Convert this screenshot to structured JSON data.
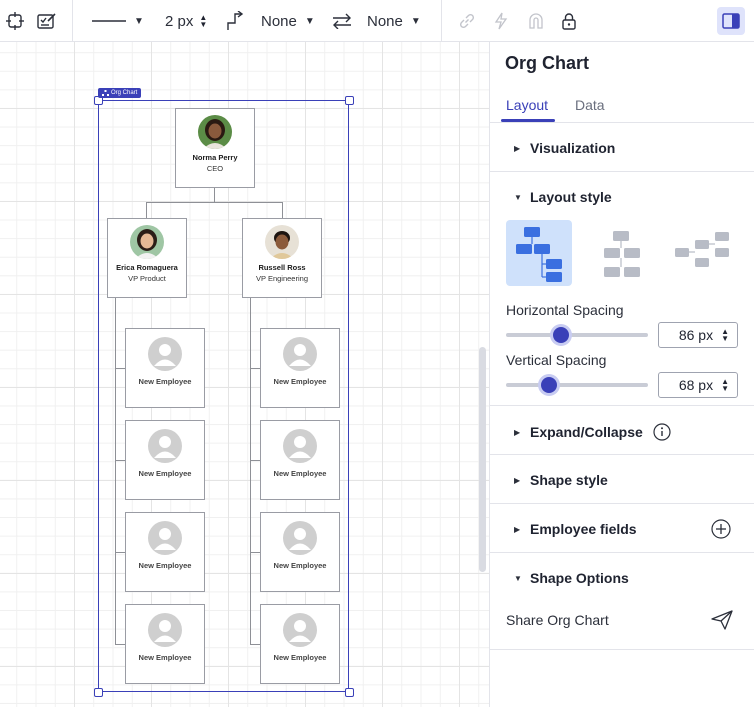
{
  "toolbar": {
    "line_width": "2 px",
    "start_arrow": "None",
    "end_arrow": "None",
    "icons": [
      "crop-icon",
      "checklist-icon",
      "line-style-icon",
      "line-width-stepper",
      "connector-elbow-icon",
      "swap-arrows-icon",
      "link-icon",
      "lightning-icon",
      "magnet-icon",
      "lock-icon",
      "panel-toggle-icon"
    ]
  },
  "canvas": {
    "chart_tag": "Org Chart",
    "ceo": {
      "name": "Norma Perry",
      "title": "CEO"
    },
    "vps": [
      {
        "name": "Erica Romaguera",
        "title": "VP Product"
      },
      {
        "name": "Russell Ross",
        "title": "VP Engineering"
      }
    ],
    "employees": [
      "New Employee",
      "New Employee",
      "New Employee",
      "New Employee",
      "New Employee",
      "New Employee",
      "New Employee",
      "New Employee"
    ]
  },
  "panel": {
    "title": "Org Chart",
    "tabs": [
      {
        "label": "Layout",
        "active": true
      },
      {
        "label": "Data",
        "active": false
      }
    ],
    "sections": {
      "visualization": "Visualization",
      "layout_style": "Layout style",
      "expand_collapse": "Expand/Collapse",
      "shape_style": "Shape style",
      "employee_fields": "Employee fields",
      "shape_options": "Shape Options"
    },
    "horizontal_spacing": {
      "label": "Horizontal Spacing",
      "value": "86 px",
      "slider_fraction": 0.39
    },
    "vertical_spacing": {
      "label": "Vertical Spacing",
      "value": "68 px",
      "slider_fraction": 0.3
    },
    "share_label": "Share Org Chart",
    "accent_color": "#3a40b8",
    "active_option_color": "#cfe1fb"
  }
}
